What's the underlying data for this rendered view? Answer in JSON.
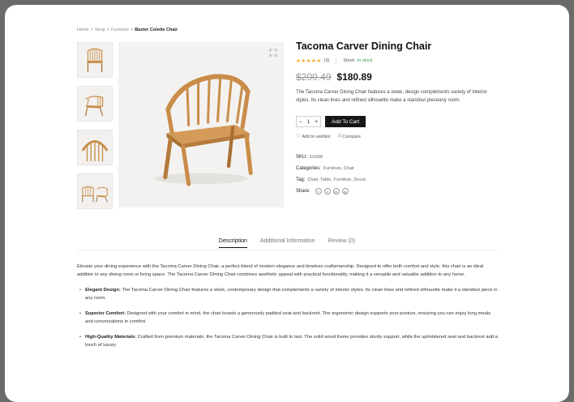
{
  "breadcrumb": {
    "items": [
      "Home",
      "Shop",
      "Furniture"
    ],
    "current": "Baxter Colette Chair",
    "separator": ">"
  },
  "product": {
    "title": "Tacoma Carver Dining Chair",
    "stars": "★★★★★",
    "review_count": "(3)",
    "stock_label": "Stock:",
    "stock_value": "In stock",
    "old_price": "$200.49",
    "new_price": "$180.89",
    "description": "The Tacoma Carver Dining Chair features a sleek, design complements variety of interior styles. Its clean lines and refined silhouette make a standout pieceany room.",
    "qty_minus": "–",
    "qty_value": "1",
    "qty_plus": "+",
    "add_to_cart": "Add To Cart",
    "wishlist_label": "Add to wishlist",
    "compare_label": "Compare",
    "sku_label": "SKU:",
    "sku_value": "D1008",
    "categories_label": "Categories:",
    "categories_value": "Furniture, Chair",
    "tag_label": "Tag:",
    "tag_value": "Chair, Table, Furniture, Decor,",
    "share_label": "Share:",
    "social": [
      "f",
      "x",
      "in",
      "ig"
    ]
  },
  "tabs": [
    "Description",
    "Additional Information",
    "Review (0)"
  ],
  "description_tab": {
    "intro": "Elevate your dining experience with the Tacoma Carver Dining Chair, a perfect blend of modern elegance and timeless craftsmanship. Designed to offer both comfort and style, this chair is an ideal addition to any dining room or living space. The Tacoma Carver Dining Chair combines aesthetic appeal with practical functionality, making it a versatile and valuable addition to any home.",
    "bullets": [
      {
        "title": "Elegant Design:",
        "text": "The Tacoma Carver Dining Chair features a sleek, contemporary design that complements a variety of interior styles. Its clean lines and refined silhouette make it a standout piece in any room."
      },
      {
        "title": "Superior Comfort:",
        "text": "Designed with your comfort in mind, the chair boasts a generously padded seat and backrest. The ergonomic design supports your posture, ensuring you can enjoy long meals and conversations in comfort."
      },
      {
        "title": "High-Quality Materials:",
        "text": "Crafted from premium materials, the Tacoma Carver Dining Chair is built to last. The solid wood frame provides sturdy support, while the upholstered seat and backrest add a touch of luxury."
      }
    ]
  },
  "colors": {
    "wood": "#c98d4a",
    "wood_dark": "#a86f33",
    "star": "#f4a41c",
    "stock": "#3a9b4a",
    "button": "#161616"
  }
}
